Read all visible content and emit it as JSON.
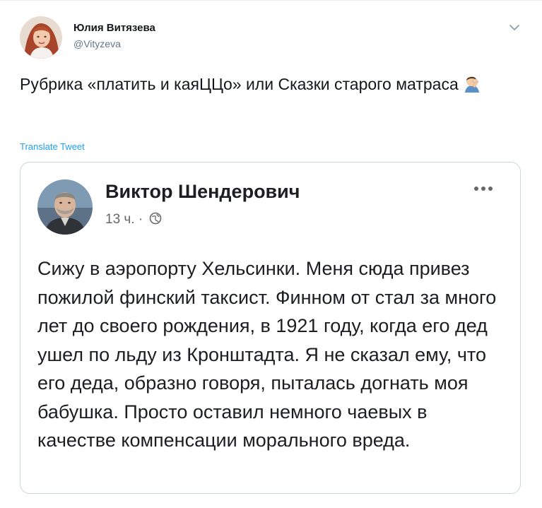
{
  "tweet": {
    "author": {
      "name": "Юлия Витязева",
      "handle": "@Vityzeva"
    },
    "text": "Рубрика «платить и каяЦЦо» или Сказки старого матраса",
    "emoji": "person-facepalming",
    "translate_label": "Translate Tweet",
    "colors": {
      "link": "#1da1f2",
      "secondary": "#657786"
    }
  },
  "embed": {
    "author": {
      "name": "Виктор Шендерович",
      "time": "13 ч. ·"
    },
    "privacy_icon": "globe-icon",
    "more_icon": "more-horizontal-icon",
    "text": "Сижу в аэропорту Хельсинки. Меня сюда привез пожилой финский таксист. Финном от стал за много лет до своего рождения, в 1921 году, когда его дед ушел по льду из Кронштадта. Я не сказал ему, что его деда, образно говоря, пыталась догнать моя бабушка. Просто оставил немного чаевых в качестве компенсации морального вреда."
  }
}
